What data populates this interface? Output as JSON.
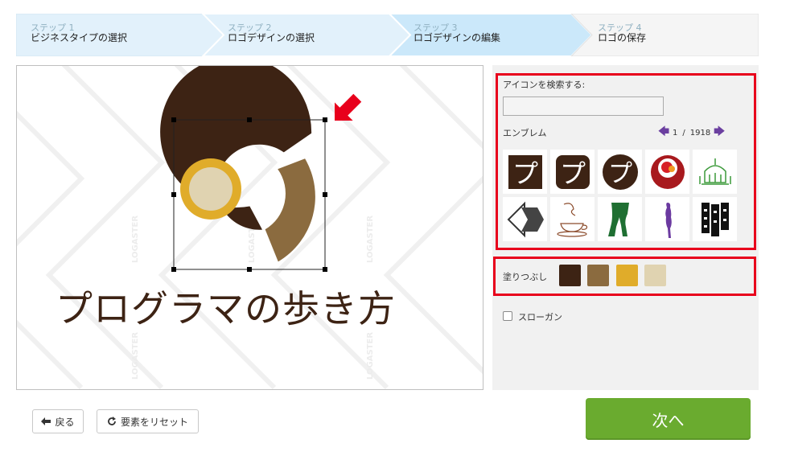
{
  "steps": [
    {
      "num": "ステップ 1",
      "name": "ビジネスタイプの選択"
    },
    {
      "num": "ステップ 2",
      "name": "ロゴデザインの選択"
    },
    {
      "num": "ステップ 3",
      "name": "ロゴデザインの編集"
    },
    {
      "num": "ステップ 4",
      "name": "ロゴの保存"
    }
  ],
  "canvas": {
    "logo_text": "プログラマの歩き方",
    "watermark": "LOGASTER"
  },
  "panel": {
    "search_label": "アイコンを検索する:",
    "search_value": "",
    "category": "エンブレム",
    "page_current": "1",
    "page_separator": "/",
    "page_total": "1918",
    "icons": [
      "katakana-pu-square-icon",
      "katakana-pu-rounded-icon",
      "katakana-pu-circle-icon",
      "red-circle-emblem-icon",
      "green-palace-icon",
      "arrow-diamond-icon",
      "coffee-cup-icon",
      "green-legs-icon",
      "purple-figure-icon",
      "black-bars-icon"
    ],
    "fill_label": "塗りつぶし",
    "colors": [
      "#3d2314",
      "#8b6b3f",
      "#e0ac2a",
      "#e0d3b1"
    ],
    "slogan_label": "スローガン"
  },
  "buttons": {
    "back": "戻る",
    "reset": "要素をリセット",
    "next": "次へ"
  }
}
